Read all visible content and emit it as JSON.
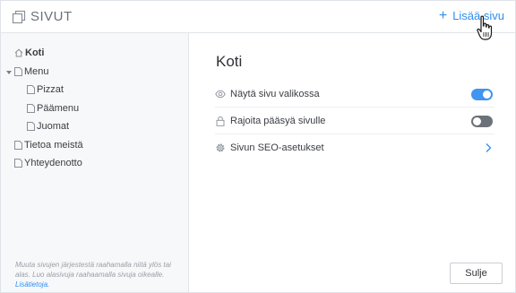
{
  "header": {
    "title": "SIVUT",
    "add_page_label": "Lisää sivu"
  },
  "sidebar": {
    "items": [
      {
        "label": "Koti",
        "icon": "home-icon",
        "active": true
      },
      {
        "label": "Menu",
        "icon": "page-icon",
        "expanded": true
      },
      {
        "label": "Pizzat",
        "icon": "page-icon"
      },
      {
        "label": "Päämenu",
        "icon": "page-icon"
      },
      {
        "label": "Juomat",
        "icon": "page-icon"
      },
      {
        "label": "Tietoa meistä",
        "icon": "page-icon"
      },
      {
        "label": "Yhteydenotto",
        "icon": "page-icon"
      }
    ],
    "hint_text": "Muuta sivujen järjestestä raahamalla niitä ylös tai alas. Luo alasivuja raahaamalla sivuja oikealle.",
    "hint_link": "Lisätietoja."
  },
  "main": {
    "page_title": "Koti",
    "settings": [
      {
        "label": "Näytä sivu valikossa",
        "icon": "eye-icon",
        "control": "toggle",
        "on": true
      },
      {
        "label": "Rajoita pääsyä sivulle",
        "icon": "lock-icon",
        "control": "toggle",
        "on": false
      },
      {
        "label": "Sivun SEO-asetukset",
        "icon": "gear-icon",
        "control": "chevron"
      }
    ],
    "close_label": "Sulje"
  },
  "colors": {
    "accent": "#2f8ef0",
    "toggle_on": "#3f95f0",
    "toggle_off": "#6d7178",
    "sidebar_bg": "#f7f8f9"
  }
}
